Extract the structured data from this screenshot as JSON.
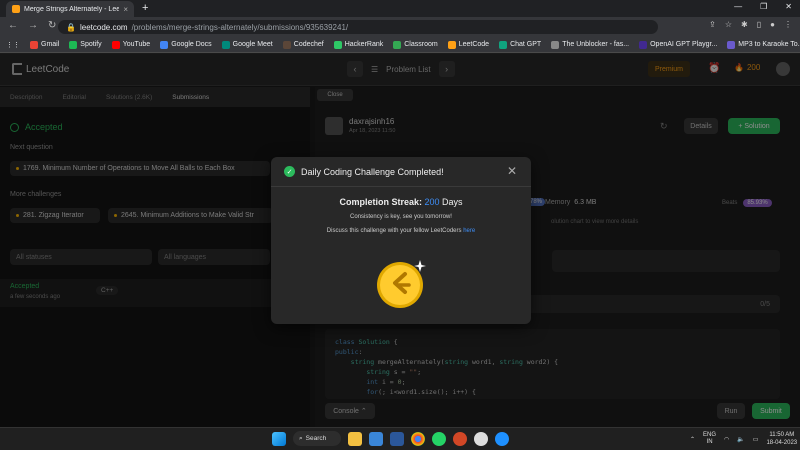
{
  "browser": {
    "tab_title": "Merge Strings Alternately - Lee",
    "tab_close": "×",
    "new_tab": "+",
    "url_domain": "leetcode.com",
    "url_path": "/problems/merge-strings-alternately/submissions/935639241/",
    "bookmarks": [
      "Gmail",
      "Spotify",
      "YouTube",
      "Google Docs",
      "Google Meet",
      "Codechef",
      "HackerRank",
      "Classroom",
      "LeetCode",
      "Chat GPT",
      "The Unblocker - fas...",
      "OpenAI GPT Playgr...",
      "MP3 to Karaoke To..."
    ]
  },
  "header": {
    "logo": "LeetCode",
    "problem_list": "Problem List",
    "premium": "Premium",
    "coins": "200"
  },
  "left": {
    "tabs": [
      "Description",
      "Editorial",
      "Solutions (2.6K)",
      "Submissions"
    ],
    "status": "Accepted",
    "next_question_label": "Next question",
    "next_question": "1769. Minimum Number of Operations to Move All Balls to Each Box",
    "more_label": "More challenges",
    "challenge1": "281. Zigzag Iterator",
    "challenge2": "2645. Minimum Additions to Make Valid Str",
    "filter_status": "All statuses",
    "filter_lang": "All languages",
    "sub_status": "Accepted",
    "sub_time": "a few seconds ago",
    "sub_lang": "C++"
  },
  "right": {
    "close": "Close",
    "username": "daxrajsinh16",
    "date": "Apr 18, 2023 11:50",
    "details": "Details",
    "solution": "+ Solution",
    "beats_left": "78%",
    "memory_label": "Memory",
    "memory_value": "6.3 MB",
    "beats_label": "Beats",
    "beats_value": "85.93%",
    "chart_hint": "olution chart to view more details",
    "case_count": "0/5",
    "console": "Console",
    "run": "Run",
    "submit": "Submit"
  },
  "modal": {
    "title": "Daily Coding Challenge Completed!",
    "streak_label": "Completion Streak:",
    "streak_num": "200",
    "streak_unit": "Days",
    "line1": "Consistency is key, see you tomorrow!",
    "line2": "Discuss this challenge with your fellow LeetCoders",
    "link": "here"
  },
  "taskbar": {
    "search": "Search",
    "lang1": "ENG",
    "lang2": "IN",
    "time": "11:50 AM",
    "date": "18-04-2023"
  },
  "colors": {
    "accent": "#ffa116",
    "green": "#2cbb5d",
    "blue": "#3e8ef7"
  }
}
